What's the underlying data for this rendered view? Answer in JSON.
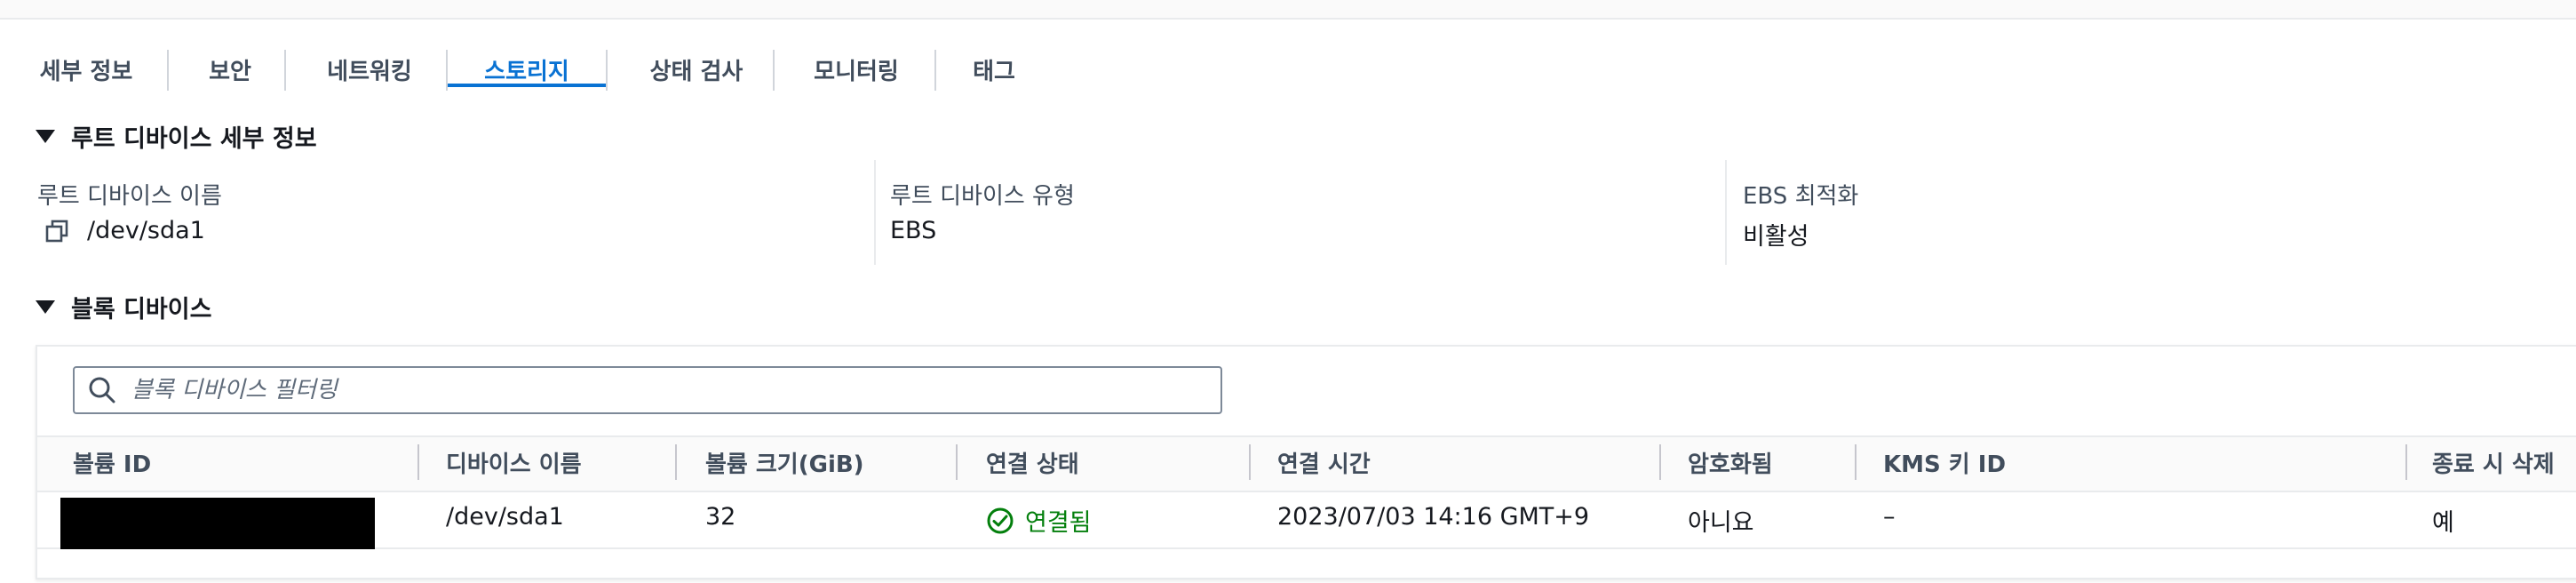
{
  "tabs": [
    {
      "label": "세부 정보",
      "active": false
    },
    {
      "label": "보안",
      "active": false
    },
    {
      "label": "네트워킹",
      "active": false
    },
    {
      "label": "스토리지",
      "active": true
    },
    {
      "label": "상태 검사",
      "active": false
    },
    {
      "label": "모니터링",
      "active": false
    },
    {
      "label": "태그",
      "active": false
    }
  ],
  "root_device": {
    "section_title": "루트 디바이스 세부 정보",
    "name_label": "루트 디바이스 이름",
    "name_value": "/dev/sda1",
    "type_label": "루트 디바이스 유형",
    "type_value": "EBS",
    "ebs_opt_label": "EBS 최적화",
    "ebs_opt_value": "비활성"
  },
  "block_devices": {
    "section_title": "블록 디바이스",
    "filter_placeholder": "블록 디바이스 필터링",
    "columns": [
      "볼륨 ID",
      "디바이스 이름",
      "볼륨 크기(GiB)",
      "연결 상태",
      "연결 시간",
      "암호화됨",
      "KMS 키 ID",
      "종료 시 삭제"
    ],
    "rows": [
      {
        "volume_id": "",
        "device_name": "/dev/sda1",
        "size": "32",
        "status": "연결됨",
        "attach_time": "2023/07/03 14:16 GMT+9",
        "encrypted": "아니요",
        "kms_key": "–",
        "delete_on_termination": "예"
      }
    ]
  },
  "colors": {
    "accent": "#0972d3",
    "success": "#037f0c",
    "text": "#16191f",
    "muted": "#414d5c"
  },
  "icons": [
    "copy-icon",
    "caret-down-icon",
    "search-icon",
    "status-success-icon"
  ]
}
